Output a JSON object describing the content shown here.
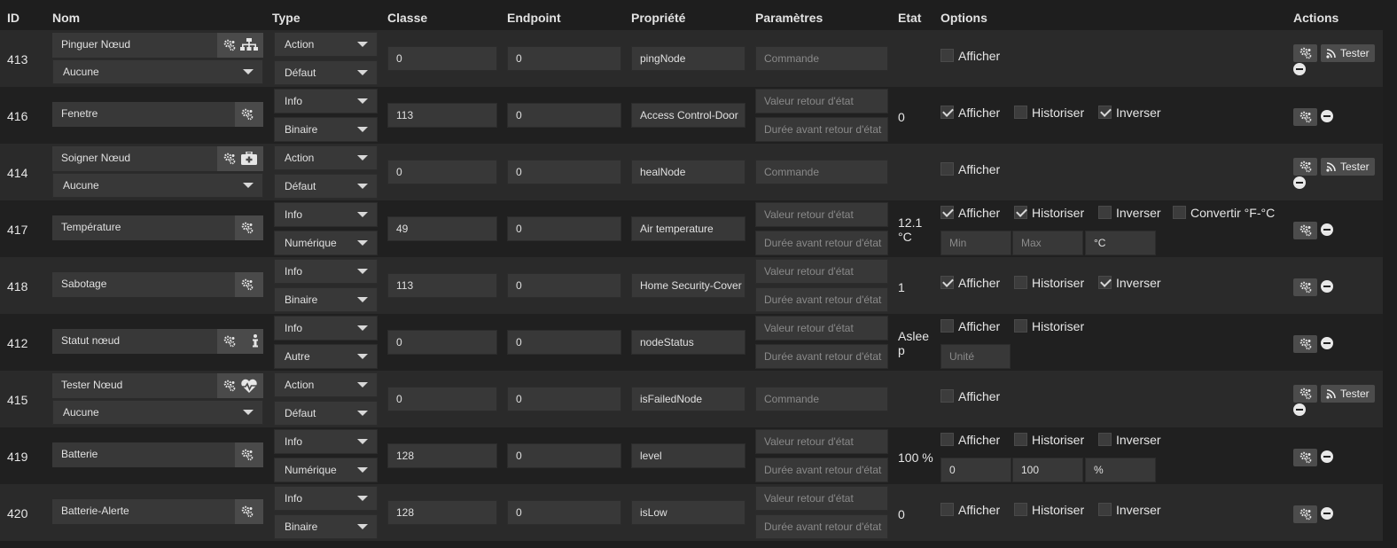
{
  "headers": {
    "id": "ID",
    "nom": "Nom",
    "type": "Type",
    "classe": "Classe",
    "endpoint": "Endpoint",
    "propriete": "Propriété",
    "parametres": "Paramètres",
    "etat": "Etat",
    "options": "Options",
    "actions": "Actions"
  },
  "placeholders": {
    "commande": "Commande",
    "valeur_retour": "Valeur retour d'état",
    "duree_retour": "Durée avant retour d'état",
    "min": "Min",
    "max": "Max",
    "unite": "Unité"
  },
  "labels": {
    "afficher": "Afficher",
    "historiser": "Historiser",
    "inverser": "Inverser",
    "convertir": "Convertir °F-°C",
    "tester": "Tester"
  },
  "rows": [
    {
      "id": "413",
      "name": "Pinguer Nœud",
      "value_select": "Aucune",
      "type": "Action",
      "subtype": "Défaut",
      "classe": "0",
      "endpoint": "0",
      "propriete": "pingNode",
      "etat": "",
      "icon": "sitemap-icon",
      "afficher": false
    },
    {
      "id": "416",
      "name": "Fenetre",
      "type": "Info",
      "subtype": "Binaire",
      "classe": "113",
      "endpoint": "0",
      "propriete": "Access Control-Door",
      "etat": "0",
      "afficher": true,
      "historiser": false,
      "inverser": true
    },
    {
      "id": "414",
      "name": "Soigner Nœud",
      "value_select": "Aucune",
      "type": "Action",
      "subtype": "Défaut",
      "classe": "0",
      "endpoint": "0",
      "propriete": "healNode",
      "etat": "",
      "icon": "medkit-icon",
      "afficher": false
    },
    {
      "id": "417",
      "name": "Température",
      "type": "Info",
      "subtype": "Numérique",
      "classe": "49",
      "endpoint": "0",
      "propriete": "Air temperature",
      "etat_line1": "12.1",
      "etat_line2": "°C",
      "afficher": true,
      "historiser": true,
      "inverser": false,
      "convertir": false,
      "min": "",
      "max": "",
      "unite": "°C"
    },
    {
      "id": "418",
      "name": "Sabotage",
      "type": "Info",
      "subtype": "Binaire",
      "classe": "113",
      "endpoint": "0",
      "propriete": "Home Security-Cover",
      "etat": "1",
      "afficher": true,
      "historiser": false,
      "inverser": true
    },
    {
      "id": "412",
      "name": "Statut nœud",
      "type": "Info",
      "subtype": "Autre",
      "classe": "0",
      "endpoint": "0",
      "propriete": "nodeStatus",
      "etat_line1": "Aslee",
      "etat_line2": "p",
      "icon": "info-icon",
      "afficher": false,
      "historiser": false,
      "unite": ""
    },
    {
      "id": "415",
      "name": "Tester Nœud",
      "value_select": "Aucune",
      "type": "Action",
      "subtype": "Défaut",
      "classe": "0",
      "endpoint": "0",
      "propriete": "isFailedNode",
      "etat": "",
      "icon": "heartbeat-icon",
      "afficher": false
    },
    {
      "id": "419",
      "name": "Batterie",
      "type": "Info",
      "subtype": "Numérique",
      "classe": "128",
      "endpoint": "0",
      "propriete": "level",
      "etat": "100 %",
      "afficher": false,
      "historiser": false,
      "inverser": false,
      "min": "0",
      "max": "100",
      "unite": "%"
    },
    {
      "id": "420",
      "name": "Batterie-Alerte",
      "type": "Info",
      "subtype": "Binaire",
      "classe": "128",
      "endpoint": "0",
      "propriete": "isLow",
      "etat": "0",
      "afficher": false,
      "historiser": false,
      "inverser": false
    }
  ]
}
